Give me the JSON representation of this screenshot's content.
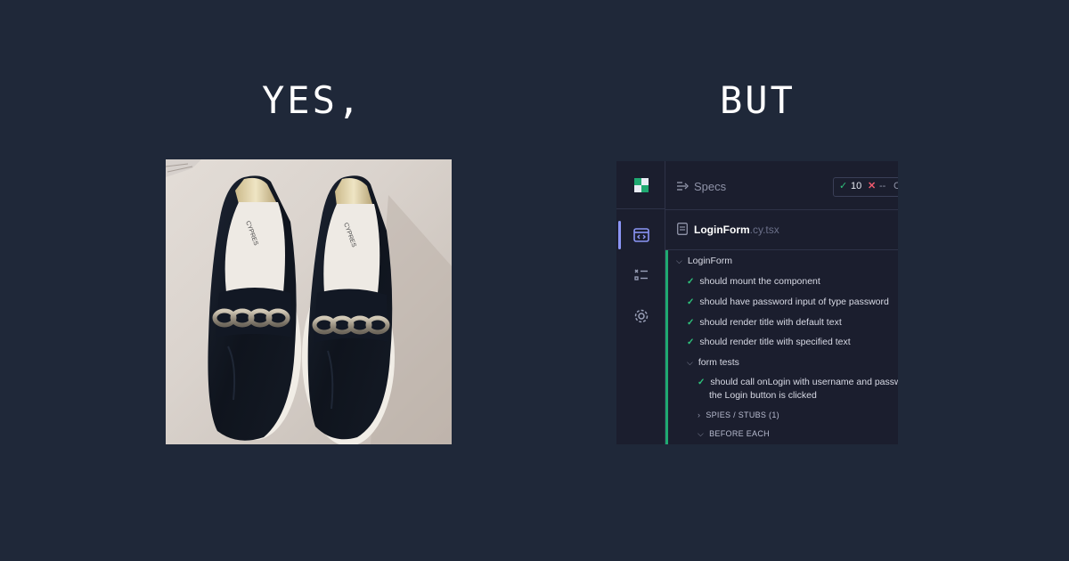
{
  "headings": {
    "left": "YES,",
    "right": "BUT"
  },
  "photo": {
    "description_icon": "black-loafers-with-gold-chain",
    "insole_brand": "CYPRES"
  },
  "cypress": {
    "header": {
      "specs_label": "Specs"
    },
    "stats": {
      "passed": "10",
      "failed": "--",
      "pending": "C"
    },
    "file": {
      "name": "LoginForm",
      "ext": ".cy.tsx"
    },
    "suite": {
      "name": "LoginForm"
    },
    "tests": [
      "should mount the component",
      "should have password input of type password",
      "should render title with default text",
      "should render title with specified text"
    ],
    "nested_suite": {
      "name": "form tests",
      "test_line1": "should call onLogin with username and passw",
      "test_line2": "the Login button is clicked",
      "spies": "SPIES / STUBS (1)",
      "before": "BEFORE EACH"
    },
    "colors": {
      "pass": "#2fc37c",
      "fail": "#f05a6e",
      "accent": "#8b95f5",
      "bg": "#1b1e2e"
    }
  }
}
